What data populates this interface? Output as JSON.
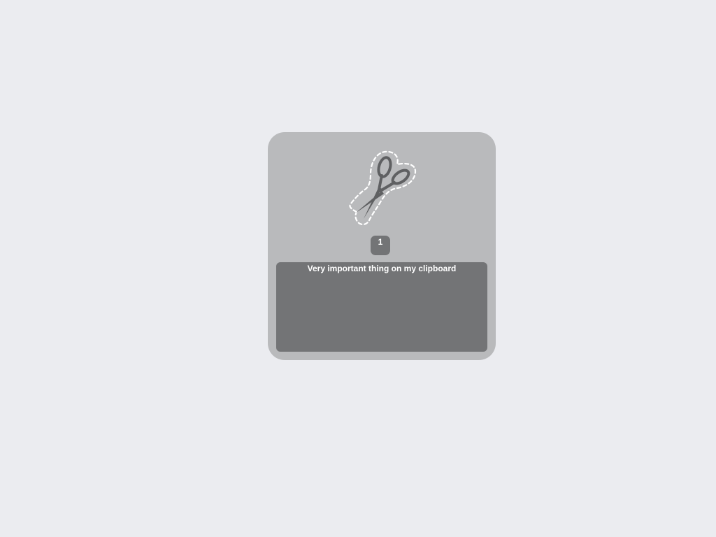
{
  "clipboard": {
    "icon": "scissors-icon",
    "count": "1",
    "item_text": "Very important thing on my clipboard"
  },
  "colors": {
    "background": "#ebecf0",
    "panel": "#b9babc",
    "box": "#737476",
    "scissors": "#5f6062",
    "text": "#ffffff"
  }
}
